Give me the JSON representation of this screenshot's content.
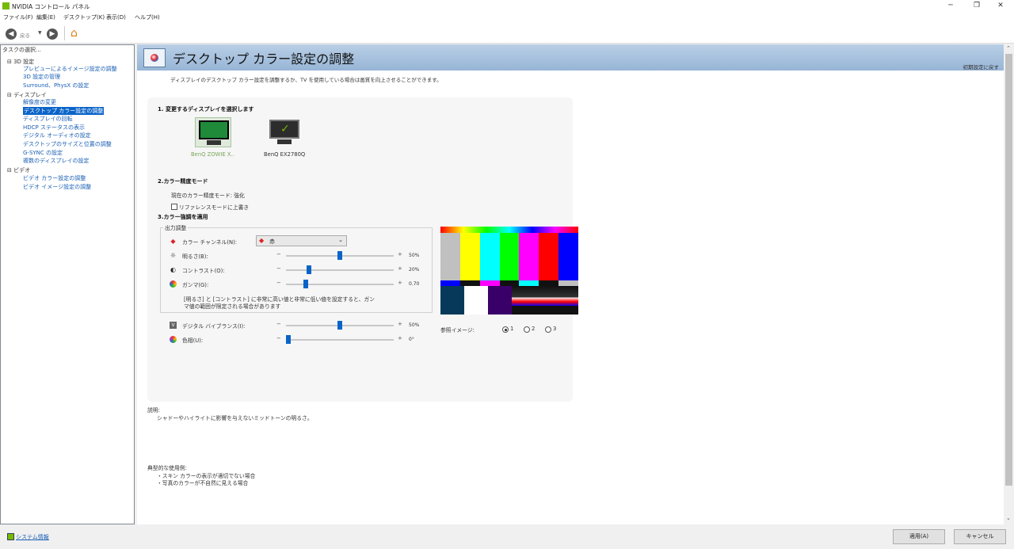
{
  "window": {
    "title": "NVIDIA コントロール パネル",
    "min": "─",
    "restore": "❐",
    "close": "✕"
  },
  "menu": [
    "ファイル(F)",
    "編集(E)",
    "デスクトップ(K)",
    "表示(D)",
    "ヘルプ(H)"
  ],
  "toolbar": {
    "back_label": "戻る"
  },
  "sidebar": {
    "header": "タスクの選択...",
    "items": [
      {
        "label": "3D 設定"
      },
      {
        "label": "プレビューによるイメージ設定の調整"
      },
      {
        "label": "3D 設定の管理"
      },
      {
        "label": "Surround、PhysX の設定"
      },
      {
        "label": "ディスプレイ"
      },
      {
        "label": "解像度の変更"
      },
      {
        "label": "デスクトップ カラー設定の調整"
      },
      {
        "label": "ディスプレイの回転"
      },
      {
        "label": "HDCP ステータスの表示"
      },
      {
        "label": "デジタル オーディオの設定"
      },
      {
        "label": "デスクトップのサイズと位置の調整"
      },
      {
        "label": "G-SYNC の設定"
      },
      {
        "label": "複数のディスプレイの設定"
      },
      {
        "label": "ビデオ"
      },
      {
        "label": "ビデオ カラー設定の調整"
      },
      {
        "label": "ビデオ イメージ設定の調整"
      }
    ]
  },
  "page": {
    "title": "デスクトップ カラー設定の調整",
    "reset": "初期設定に戻す",
    "description": "ディスプレイのデスクトップ カラー設定を調整するか、TV を使用している場合は画質を向上させることができます。"
  },
  "step1": {
    "title": "1. 変更するディスプレイを選択します",
    "displays": [
      {
        "name": "BenQ ZOWIE X..",
        "selected": true
      },
      {
        "name": "BenQ EX2780Q",
        "selected": false
      }
    ]
  },
  "step2": {
    "title": "2.カラー精度モード",
    "current": "現在のカラー精度モード: 強化",
    "override_label": "リファレンスモードに上書き",
    "override_checked": false
  },
  "step3": {
    "title": "3.カラー強調を適用",
    "output_group": "出力調整",
    "channel_label": "カラー チャンネル(N):",
    "channel_value": "赤",
    "sliders": [
      {
        "label": "明るさ(B):",
        "minus": "−",
        "plus": "+",
        "value_text": "50%",
        "fraction": 0.5
      },
      {
        "label": "コントラスト(O):",
        "minus": "−",
        "plus": "+",
        "value_text": "20%",
        "fraction": 0.2
      },
      {
        "label": "ガンマ(G):",
        "minus": "−",
        "plus": "+",
        "value_text": "0.70",
        "fraction": 0.17
      },
      {
        "label": "デジタル バイブランス(I):",
        "minus": "−",
        "plus": "+",
        "value_text": "50%",
        "fraction": 0.5
      },
      {
        "label": "色相(U):",
        "minus": "−",
        "plus": "+",
        "value_text": "0°",
        "fraction": 0.0
      }
    ],
    "warning_line1": "[明るさ] と [コントラスト] に非常に高い値と非常に低い値を設定すると、ガン",
    "warning_line2": "マ値の範囲が限定される場合があります",
    "reference_label": "参照イメージ:",
    "reference_options": [
      "1",
      "2",
      "3"
    ],
    "reference_selected": "1"
  },
  "explanation": {
    "heading": "説明:",
    "text": "シャドーやハイライトに影響を与えないミッドトーンの明るさ。"
  },
  "usage": {
    "heading": "典型的な使用例:",
    "items": [
      "・スキン カラーの表示が適切でない場合",
      "・写真のカラーが不自然に見える場合"
    ]
  },
  "status": {
    "system_info": "システム情報",
    "apply": "適用(A)",
    "cancel": "キャンセル"
  },
  "colors": {
    "nvidia_green": "#76b900",
    "selection_blue": "#0a64c8",
    "link_blue": "#1a5fb4"
  }
}
